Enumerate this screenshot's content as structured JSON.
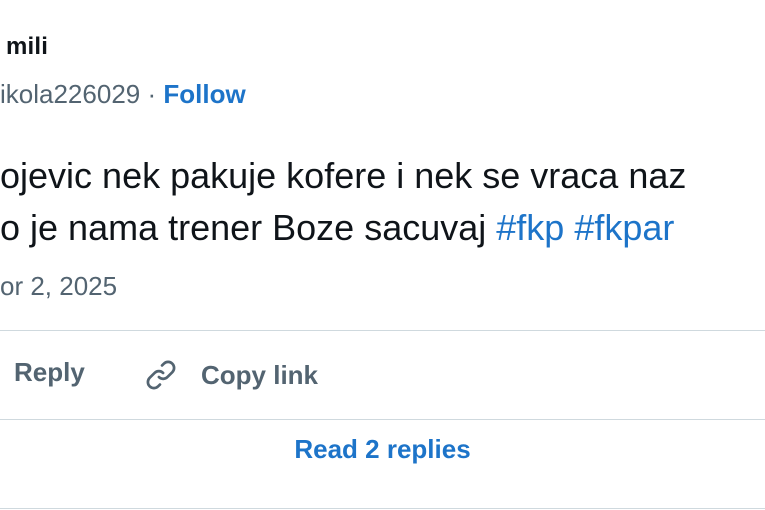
{
  "user": {
    "display_name": "mili",
    "handle": "ikola226029",
    "separator": "·",
    "follow_label": "Follow"
  },
  "tweet": {
    "line1": "ojevic nek pakuje kofere i nek se vraca naz",
    "line2_text": "o je nama trener Boze sacuvaj ",
    "hashtag1": "#fkp",
    "hashtag2": "#fkpar"
  },
  "date": "or 2, 2025",
  "actions": {
    "reply_label": "Reply",
    "copy_link_label": "Copy link",
    "copy_link_icon": "link-icon"
  },
  "read_replies_label": "Read 2 replies",
  "colors": {
    "accent": "#1d74c9",
    "text": "#0f1419",
    "secondary": "#536471",
    "divider": "#cfd9de"
  }
}
